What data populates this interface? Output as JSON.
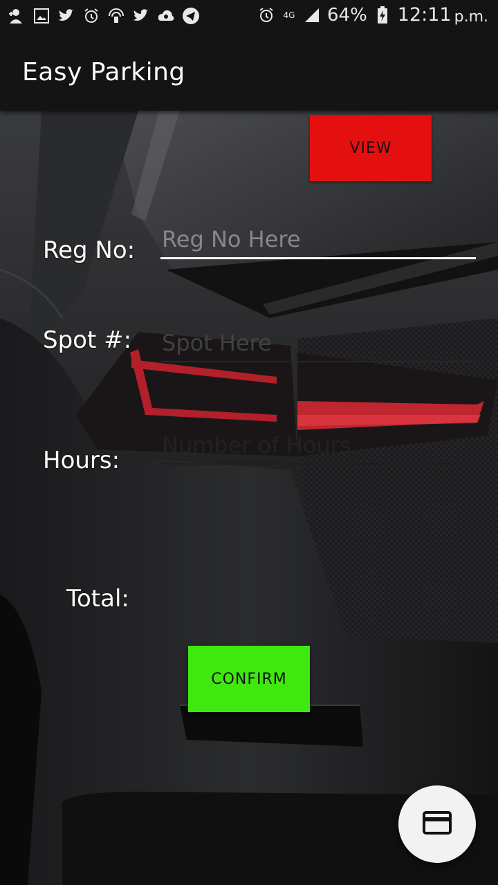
{
  "status_bar": {
    "left_icons": [
      "add-user-icon",
      "image-icon",
      "twitter-icon",
      "alarm-icon",
      "hotspot-icon",
      "twitter-icon",
      "cloud-sync-icon",
      "telegram-icon"
    ],
    "network": "4G",
    "battery": "64%",
    "time": "12:11",
    "ampm": "p.m."
  },
  "app_bar": {
    "title": "Easy Parking"
  },
  "buttons": {
    "view": "VIEW",
    "confirm": "CONFIRM"
  },
  "form": {
    "reg_label": "Reg No:",
    "reg_placeholder": "Reg No Here",
    "spot_label": "Spot #:",
    "spot_placeholder": "Spot Here",
    "hours_label": "Hours:",
    "hours_placeholder": "Number of Hours",
    "total_label": "Total:"
  },
  "fab": {
    "icon": "credit-card-icon"
  },
  "colors": {
    "view_button": "#e41010",
    "confirm_button": "#3fe80f",
    "app_bar": "#141414",
    "fab": "#f2f2f2"
  }
}
